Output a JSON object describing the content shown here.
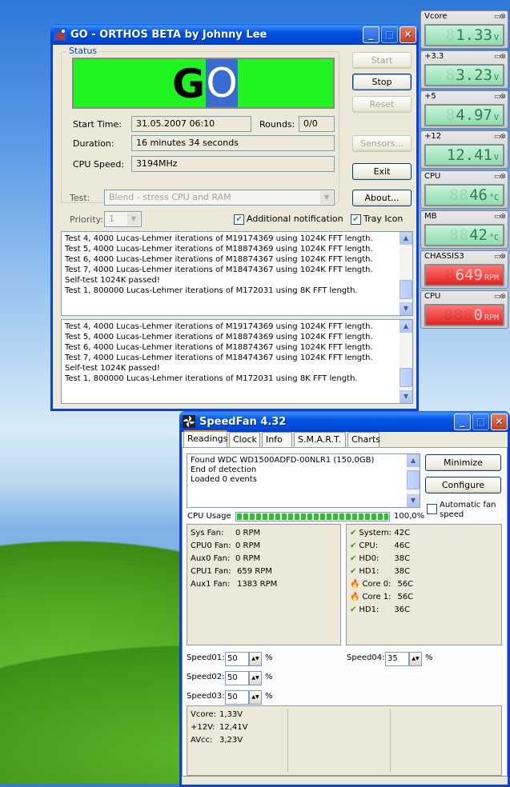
{
  "orthos": {
    "title": "GO - ORTHOS BETA by Johnny Lee",
    "status_label": "Status",
    "go_text_g": "G",
    "go_text_o": "O",
    "buttons": {
      "start": "Start",
      "stop": "Stop",
      "reset": "Reset",
      "sensors": "Sensors...",
      "exit": "Exit",
      "about": "About..."
    },
    "start_time_label": "Start Time:",
    "start_time": "31.05.2007 06:10",
    "rounds_label": "Rounds:",
    "rounds": "0/0",
    "duration_label": "Duration:",
    "duration": "16 minutes 34 seconds",
    "cpu_speed_label": "CPU Speed:",
    "cpu_speed": "3194MHz",
    "test_label": "Test:",
    "test_value": "Blend - stress CPU and RAM",
    "priority_label": "Priority:",
    "priority_value": "1",
    "additional_notification": "Additional notification",
    "tray_icon": "Tray Icon",
    "log1": [
      "Test 4, 4000 Lucas-Lehmer iterations of M19174369 using 1024K FFT length.",
      "Test 5, 4000 Lucas-Lehmer iterations of M18874369 using 1024K FFT length.",
      "Test 6, 4000 Lucas-Lehmer iterations of M18874367 using 1024K FFT length.",
      "Test 7, 4000 Lucas-Lehmer iterations of M18474367 using 1024K FFT length.",
      "Self-test 1024K passed!",
      "Test 1, 800000 Lucas-Lehmer iterations of M172031 using 8K FFT length."
    ],
    "log2": [
      "Test 4, 4000 Lucas-Lehmer iterations of M19174369 using 1024K FFT length.",
      "Test 5, 4000 Lucas-Lehmer iterations of M18874369 using 1024K FFT length.",
      "Test 6, 4000 Lucas-Lehmer iterations of M18874367 using 1024K FFT length.",
      "Test 7, 4000 Lucas-Lehmer iterations of M18474367 using 1024K FFT length.",
      "Self-test 1024K passed!",
      "Test 1, 800000 Lucas-Lehmer iterations of M172031 using 8K FFT length."
    ]
  },
  "gadgets": [
    {
      "name": "Vcore",
      "value": "1.33",
      "unit": "V",
      "style": "green"
    },
    {
      "name": "+3.3",
      "value": "3.23",
      "unit": "V",
      "style": "green"
    },
    {
      "name": "+5",
      "value": "4.97",
      "unit": "V",
      "style": "green"
    },
    {
      "name": "+12",
      "value": "12.41",
      "unit": "V",
      "style": "green"
    },
    {
      "name": "CPU",
      "value": "46",
      "unit": "°C",
      "style": "green"
    },
    {
      "name": "MB",
      "value": "42",
      "unit": "°C",
      "style": "green"
    },
    {
      "name": "CHASSIS3",
      "value": "649",
      "unit": "RPM",
      "style": "red"
    },
    {
      "name": "CPU",
      "value": "0",
      "unit": "RPM",
      "style": "red"
    }
  ],
  "speedfan": {
    "title": "SpeedFan 4.32",
    "tabs": [
      "Readings",
      "Clock",
      "Info",
      "S.M.A.R.T.",
      "Charts"
    ],
    "log": [
      "Found WDC WD1500ADFD-00NLR1 (150,0GB)",
      "End of detection",
      "Loaded 0 events"
    ],
    "minimize": "Minimize",
    "configure": "Configure",
    "auto_fan": "Automatic fan speed",
    "cpu_usage_label": "CPU Usage",
    "cpu_usage_value": "100,0%",
    "cpu_usage_fraction": 1.0,
    "fans": [
      {
        "label": "Sys Fan:",
        "value": "0 RPM"
      },
      {
        "label": "CPU0 Fan:",
        "value": "0 RPM"
      },
      {
        "label": "Aux0 Fan:",
        "value": "0 RPM"
      },
      {
        "label": "CPU1 Fan:",
        "value": "659 RPM"
      },
      {
        "label": "Aux1 Fan:",
        "value": "1383 RPM"
      }
    ],
    "temps": [
      {
        "label": "System:",
        "value": "42C",
        "icon": "check"
      },
      {
        "label": "CPU:",
        "value": "46C",
        "icon": "check"
      },
      {
        "label": "HD0:",
        "value": "38C",
        "icon": "check"
      },
      {
        "label": "HD1:",
        "value": "38C",
        "icon": "check"
      },
      {
        "label": "Core 0:",
        "value": "56C",
        "icon": "flame"
      },
      {
        "label": "Core 1:",
        "value": "56C",
        "icon": "flame"
      },
      {
        "label": "HD1:",
        "value": "36C",
        "icon": "check"
      }
    ],
    "speeds": [
      {
        "label": "Speed01:",
        "value": "50"
      },
      {
        "label": "Speed02:",
        "value": "50"
      },
      {
        "label": "Speed03:",
        "value": "50"
      },
      {
        "label": "Speed04:",
        "value": "35"
      }
    ],
    "pct": "%",
    "volts": [
      {
        "label": "Vcore:",
        "value": "1,33V"
      },
      {
        "label": "+12V:",
        "value": "12,41V"
      },
      {
        "label": "AVcc:",
        "value": "3,23V"
      }
    ]
  }
}
